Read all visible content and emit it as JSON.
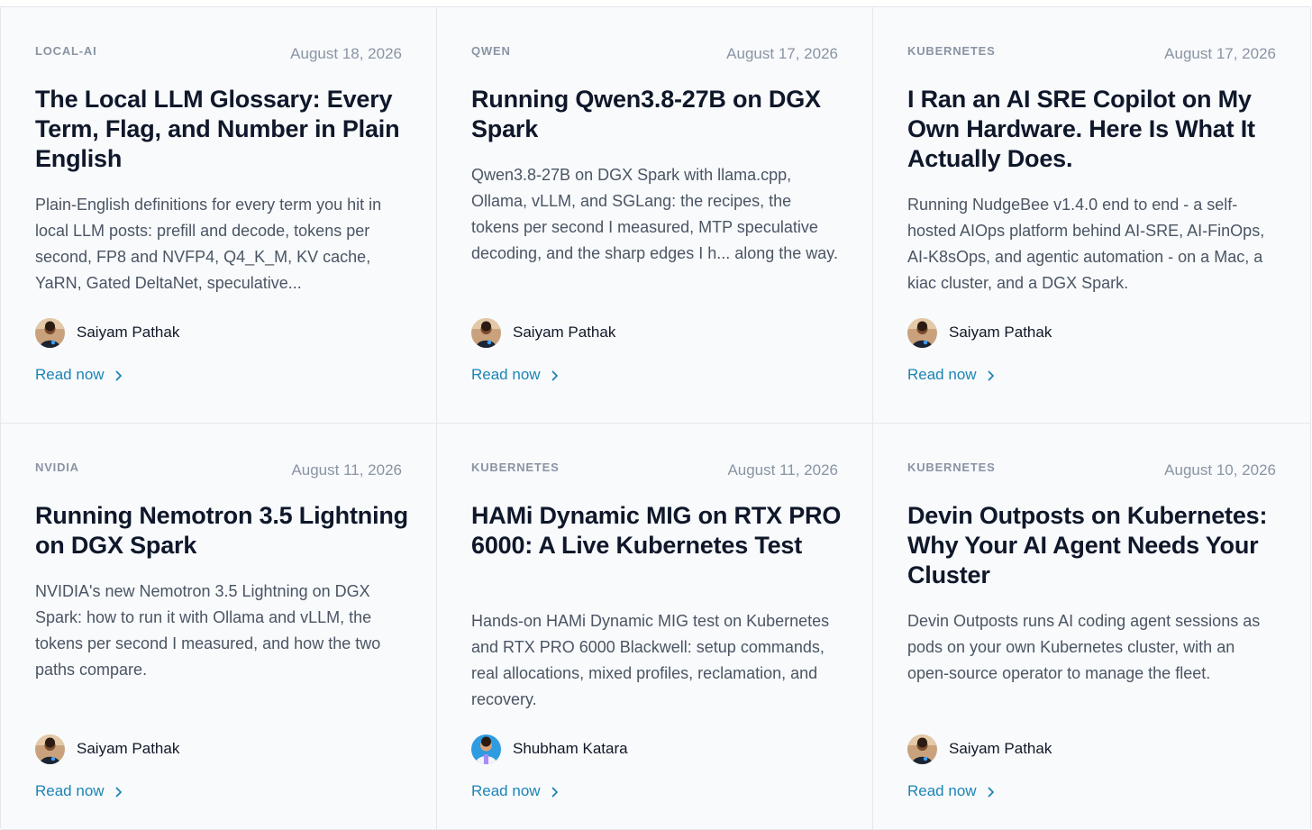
{
  "read_label": "Read now",
  "posts": [
    {
      "tag": "LOCAL-AI",
      "date": "August 18, 2026",
      "title": "The Local LLM Glossary: Every Term, Flag, and Number in Plain English",
      "excerpt": "Plain-English definitions for every term you hit in local LLM posts: prefill and decode, tokens per second, FP8 and NVFP4, Q4_K_M, KV cache, YaRN, Gated DeltaNet, speculative...",
      "author": "Saiyam Pathak",
      "avatar": "saiyam-avatar"
    },
    {
      "tag": "QWEN",
      "date": "August 17, 2026",
      "title": "Running Qwen3.8-27B on DGX Spark",
      "excerpt": "Qwen3.8-27B on DGX Spark with llama.cpp, Ollama, vLLM, and SGLang: the recipes, the tokens per second I measured, MTP speculative decoding, and the sharp edges I h... along the way.",
      "author": "Saiyam Pathak",
      "avatar": "saiyam-avatar"
    },
    {
      "tag": "KUBERNETES",
      "date": "August 17, 2026",
      "title": "I Ran an AI SRE Copilot on My Own Hardware. Here Is What It Actually Does.",
      "excerpt": "Running NudgeBee v1.4.0 end to end - a self-hosted AIOps platform behind AI-SRE, AI-FinOps, AI-K8sOps, and agentic automation - on a Mac, a kiac cluster, and a DGX Spark.",
      "author": "Saiyam Pathak",
      "avatar": "saiyam-avatar"
    },
    {
      "tag": "NVIDIA",
      "date": "August 11, 2026",
      "title": "Running Nemotron 3.5 Lightning on DGX Spark",
      "excerpt": "NVIDIA's new Nemotron 3.5 Lightning on DGX Spark: how to run it with Ollama and vLLM, the tokens per second I measured, and how the two paths compare.",
      "author": "Saiyam Pathak",
      "avatar": "saiyam-avatar"
    },
    {
      "tag": "KUBERNETES",
      "date": "August 11, 2026",
      "title": "HAMi Dynamic MIG on RTX PRO 6000: A Live Kubernetes Test",
      "excerpt": "Hands-on HAMi Dynamic MIG test on Kubernetes and RTX PRO 6000 Blackwell: setup commands, real allocations, mixed profiles, reclamation, and recovery.",
      "author": "Shubham Katara",
      "avatar": "shubham-avatar"
    },
    {
      "tag": "KUBERNETES",
      "date": "August 10, 2026",
      "title": "Devin Outposts on Kubernetes: Why Your AI Agent Needs Your Cluster",
      "excerpt": "Devin Outposts runs AI coding agent sessions as pods on your own Kubernetes cluster, with an open-source operator to manage the fleet.",
      "author": "Saiyam Pathak",
      "avatar": "saiyam-avatar"
    }
  ]
}
